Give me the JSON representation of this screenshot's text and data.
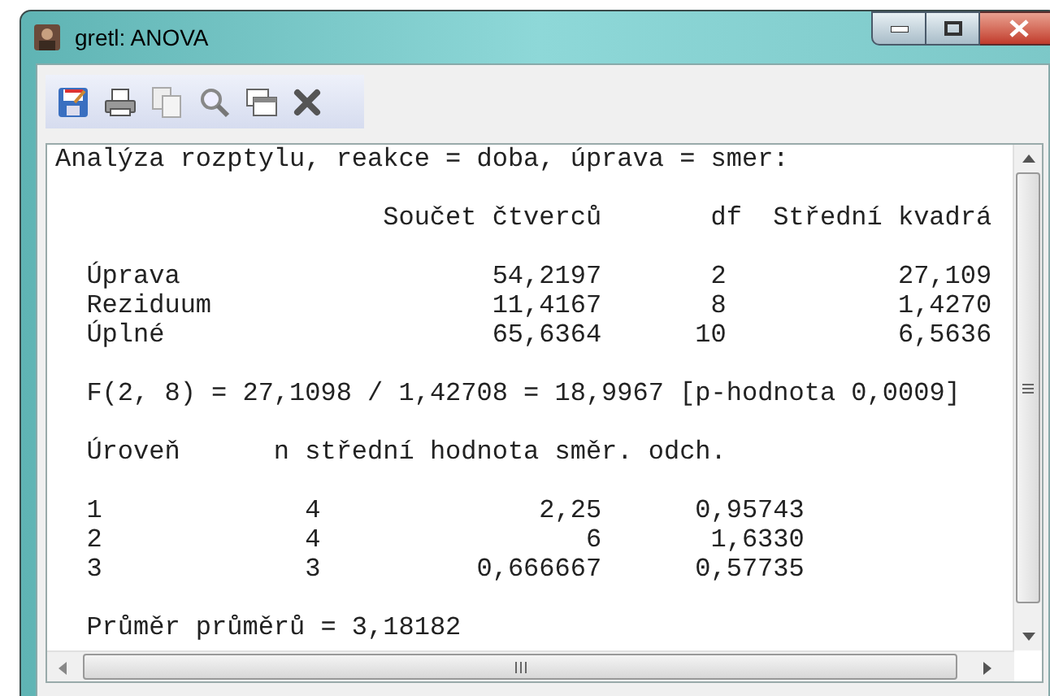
{
  "window": {
    "title": "gretl: ANOVA"
  },
  "heading": "Analýza rozptylu, reakce = doba, úprava = smer:",
  "anova": {
    "columns": [
      "Součet čtverců",
      "df",
      "Střední kvadrá"
    ],
    "rows": [
      {
        "label": "Úprava",
        "values": [
          "54,2197",
          "2",
          "27,109"
        ]
      },
      {
        "label": "Reziduum",
        "values": [
          "11,4167",
          "8",
          "1,4270"
        ]
      },
      {
        "label": "Úplné",
        "values": [
          "65,6364",
          "10",
          "6,5636"
        ]
      }
    ]
  },
  "f_test": "F(2, 8) = 27,1098 / 1,42708 = 18,9967 [p-hodnota 0,0009]",
  "levels": {
    "columns": [
      "Úroveň",
      "n střední hodnota směr. odch."
    ],
    "rows": [
      {
        "values": [
          "1",
          "4",
          "2,25",
          "0,95743"
        ]
      },
      {
        "values": [
          "2",
          "4",
          "6",
          "1,6330"
        ]
      },
      {
        "values": [
          "3",
          "3",
          "0,666667",
          "0,57735"
        ]
      }
    ]
  },
  "grand_mean": "Průměr průměrů = 3,18182"
}
